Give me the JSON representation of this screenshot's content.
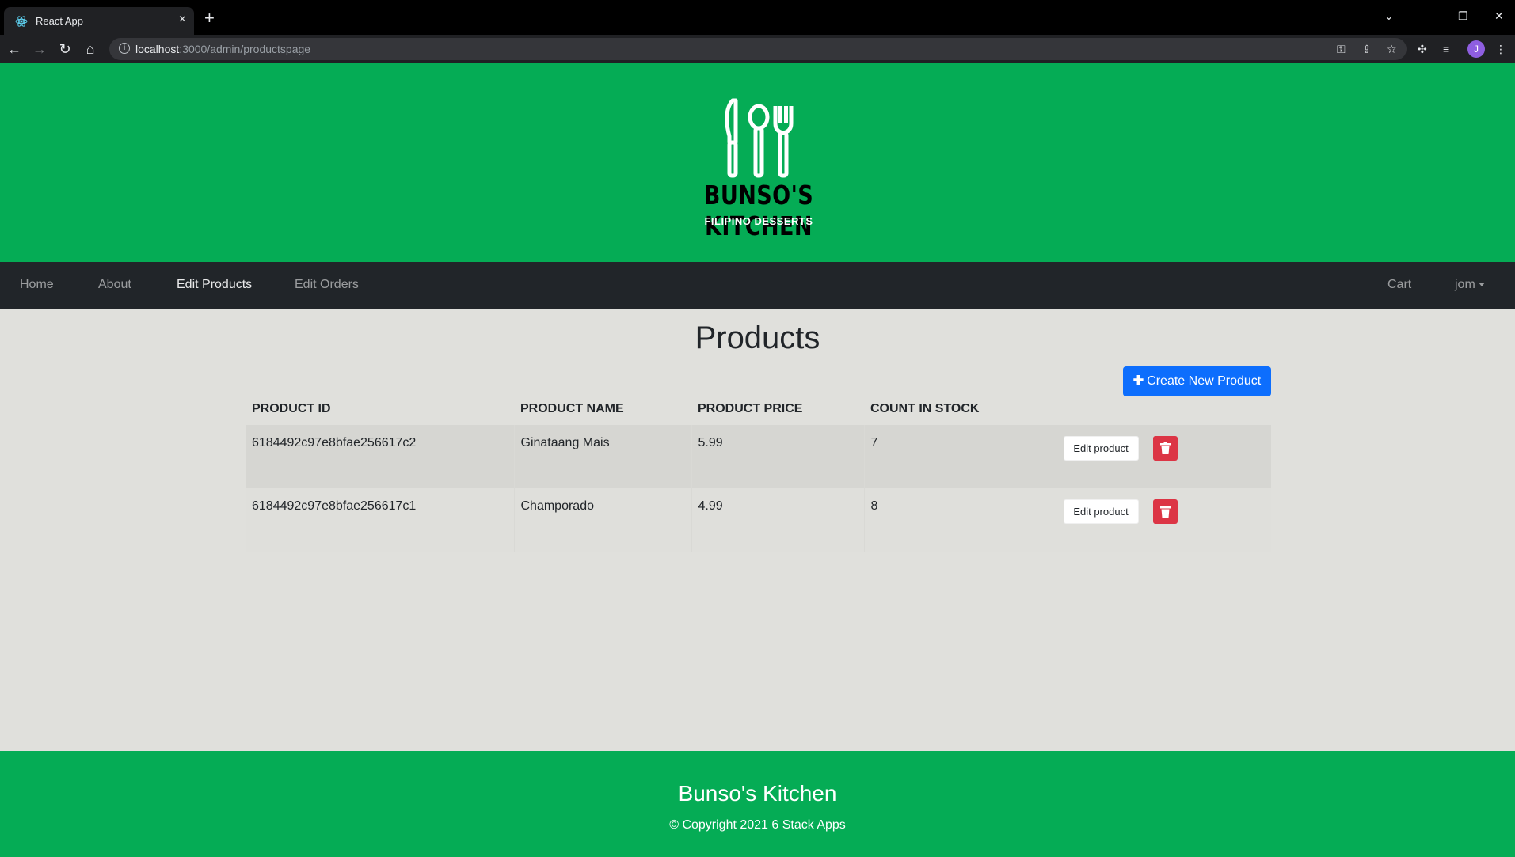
{
  "browser": {
    "tab_title": "React App",
    "url_host": "localhost",
    "url_path": ":3000/admin/productspage",
    "profile_initial": "J"
  },
  "brand": {
    "logo_title": "BUNSO'S KITCHEN",
    "logo_subtitle": "FILIPINO DESSERTS"
  },
  "nav": {
    "left": [
      "Home",
      "About",
      "Edit Products",
      "Edit Orders"
    ],
    "active": "Edit Products",
    "right": [
      "Cart",
      "jom"
    ]
  },
  "main": {
    "title": "Products",
    "create_label": "Create New Product",
    "columns": [
      "PRODUCT ID",
      "PRODUCT NAME",
      "PRODUCT PRICE",
      "COUNT IN STOCK"
    ],
    "rows": [
      {
        "id": "6184492c97e8bfae256617c2",
        "name": "Ginataang Mais",
        "price": "5.99",
        "stock": "7"
      },
      {
        "id": "6184492c97e8bfae256617c1",
        "name": "Champorado",
        "price": "4.99",
        "stock": "8"
      }
    ],
    "edit_label": "Edit product"
  },
  "footer": {
    "brand": "Bunso's Kitchen",
    "copyright": "© Copyright 2021 6 Stack Apps"
  },
  "colors": {
    "brand_green": "#05ac55",
    "navbar": "#212529",
    "primary": "#0d6efd",
    "danger": "#dc3545"
  }
}
